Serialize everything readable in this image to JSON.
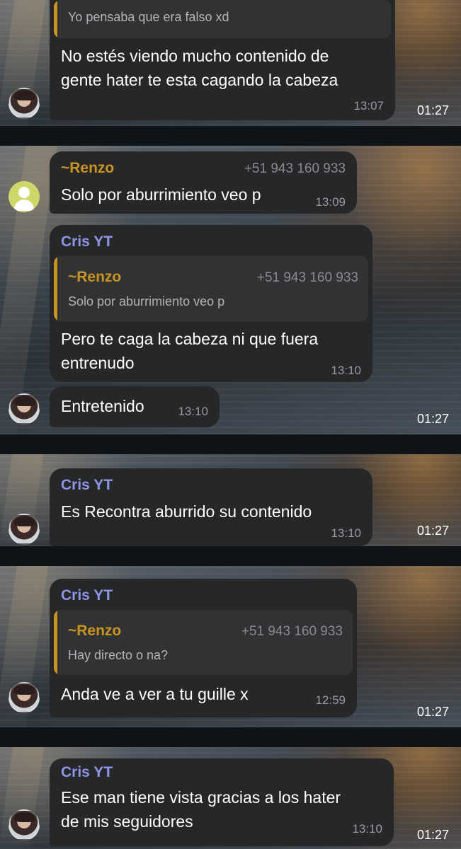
{
  "story_time": "01:27",
  "panel1": {
    "quote_text": "Yo pensaba que era falso xd",
    "message": [
      "No estés viendo mucho contenido de",
      "gente hater te esta cagando la cabeza"
    ],
    "time": "13:07"
  },
  "panel2": {
    "msg1": {
      "sender": "~Renzo",
      "phone": "+51 943 160 933",
      "text": "Solo por aburrimiento veo p",
      "time": "13:09"
    },
    "msg2": {
      "sender": "Cris YT",
      "quote": {
        "name": "~Renzo",
        "phone": "+51 943 160 933",
        "text": "Solo por aburrimiento veo p"
      },
      "text": [
        "Pero te caga la cabeza ni que fuera",
        "entrenudo"
      ],
      "time": "13:10"
    },
    "msg3": {
      "text": "Entretenido",
      "time": "13:10"
    }
  },
  "panel3": {
    "sender": "Cris YT",
    "text": "Es Recontra aburrido su contenido",
    "time": "13:10"
  },
  "panel4": {
    "sender": "Cris YT",
    "quote": {
      "name": "~Renzo",
      "phone": "+51 943 160 933",
      "text": "Hay directo o na?"
    },
    "text": "Anda ve a ver a tu guille x",
    "time": "12:59"
  },
  "panel5": {
    "sender": "Cris YT",
    "text": [
      "Ese man tiene vista gracias a los hater",
      "de mis seguidores"
    ],
    "time": "13:10"
  }
}
